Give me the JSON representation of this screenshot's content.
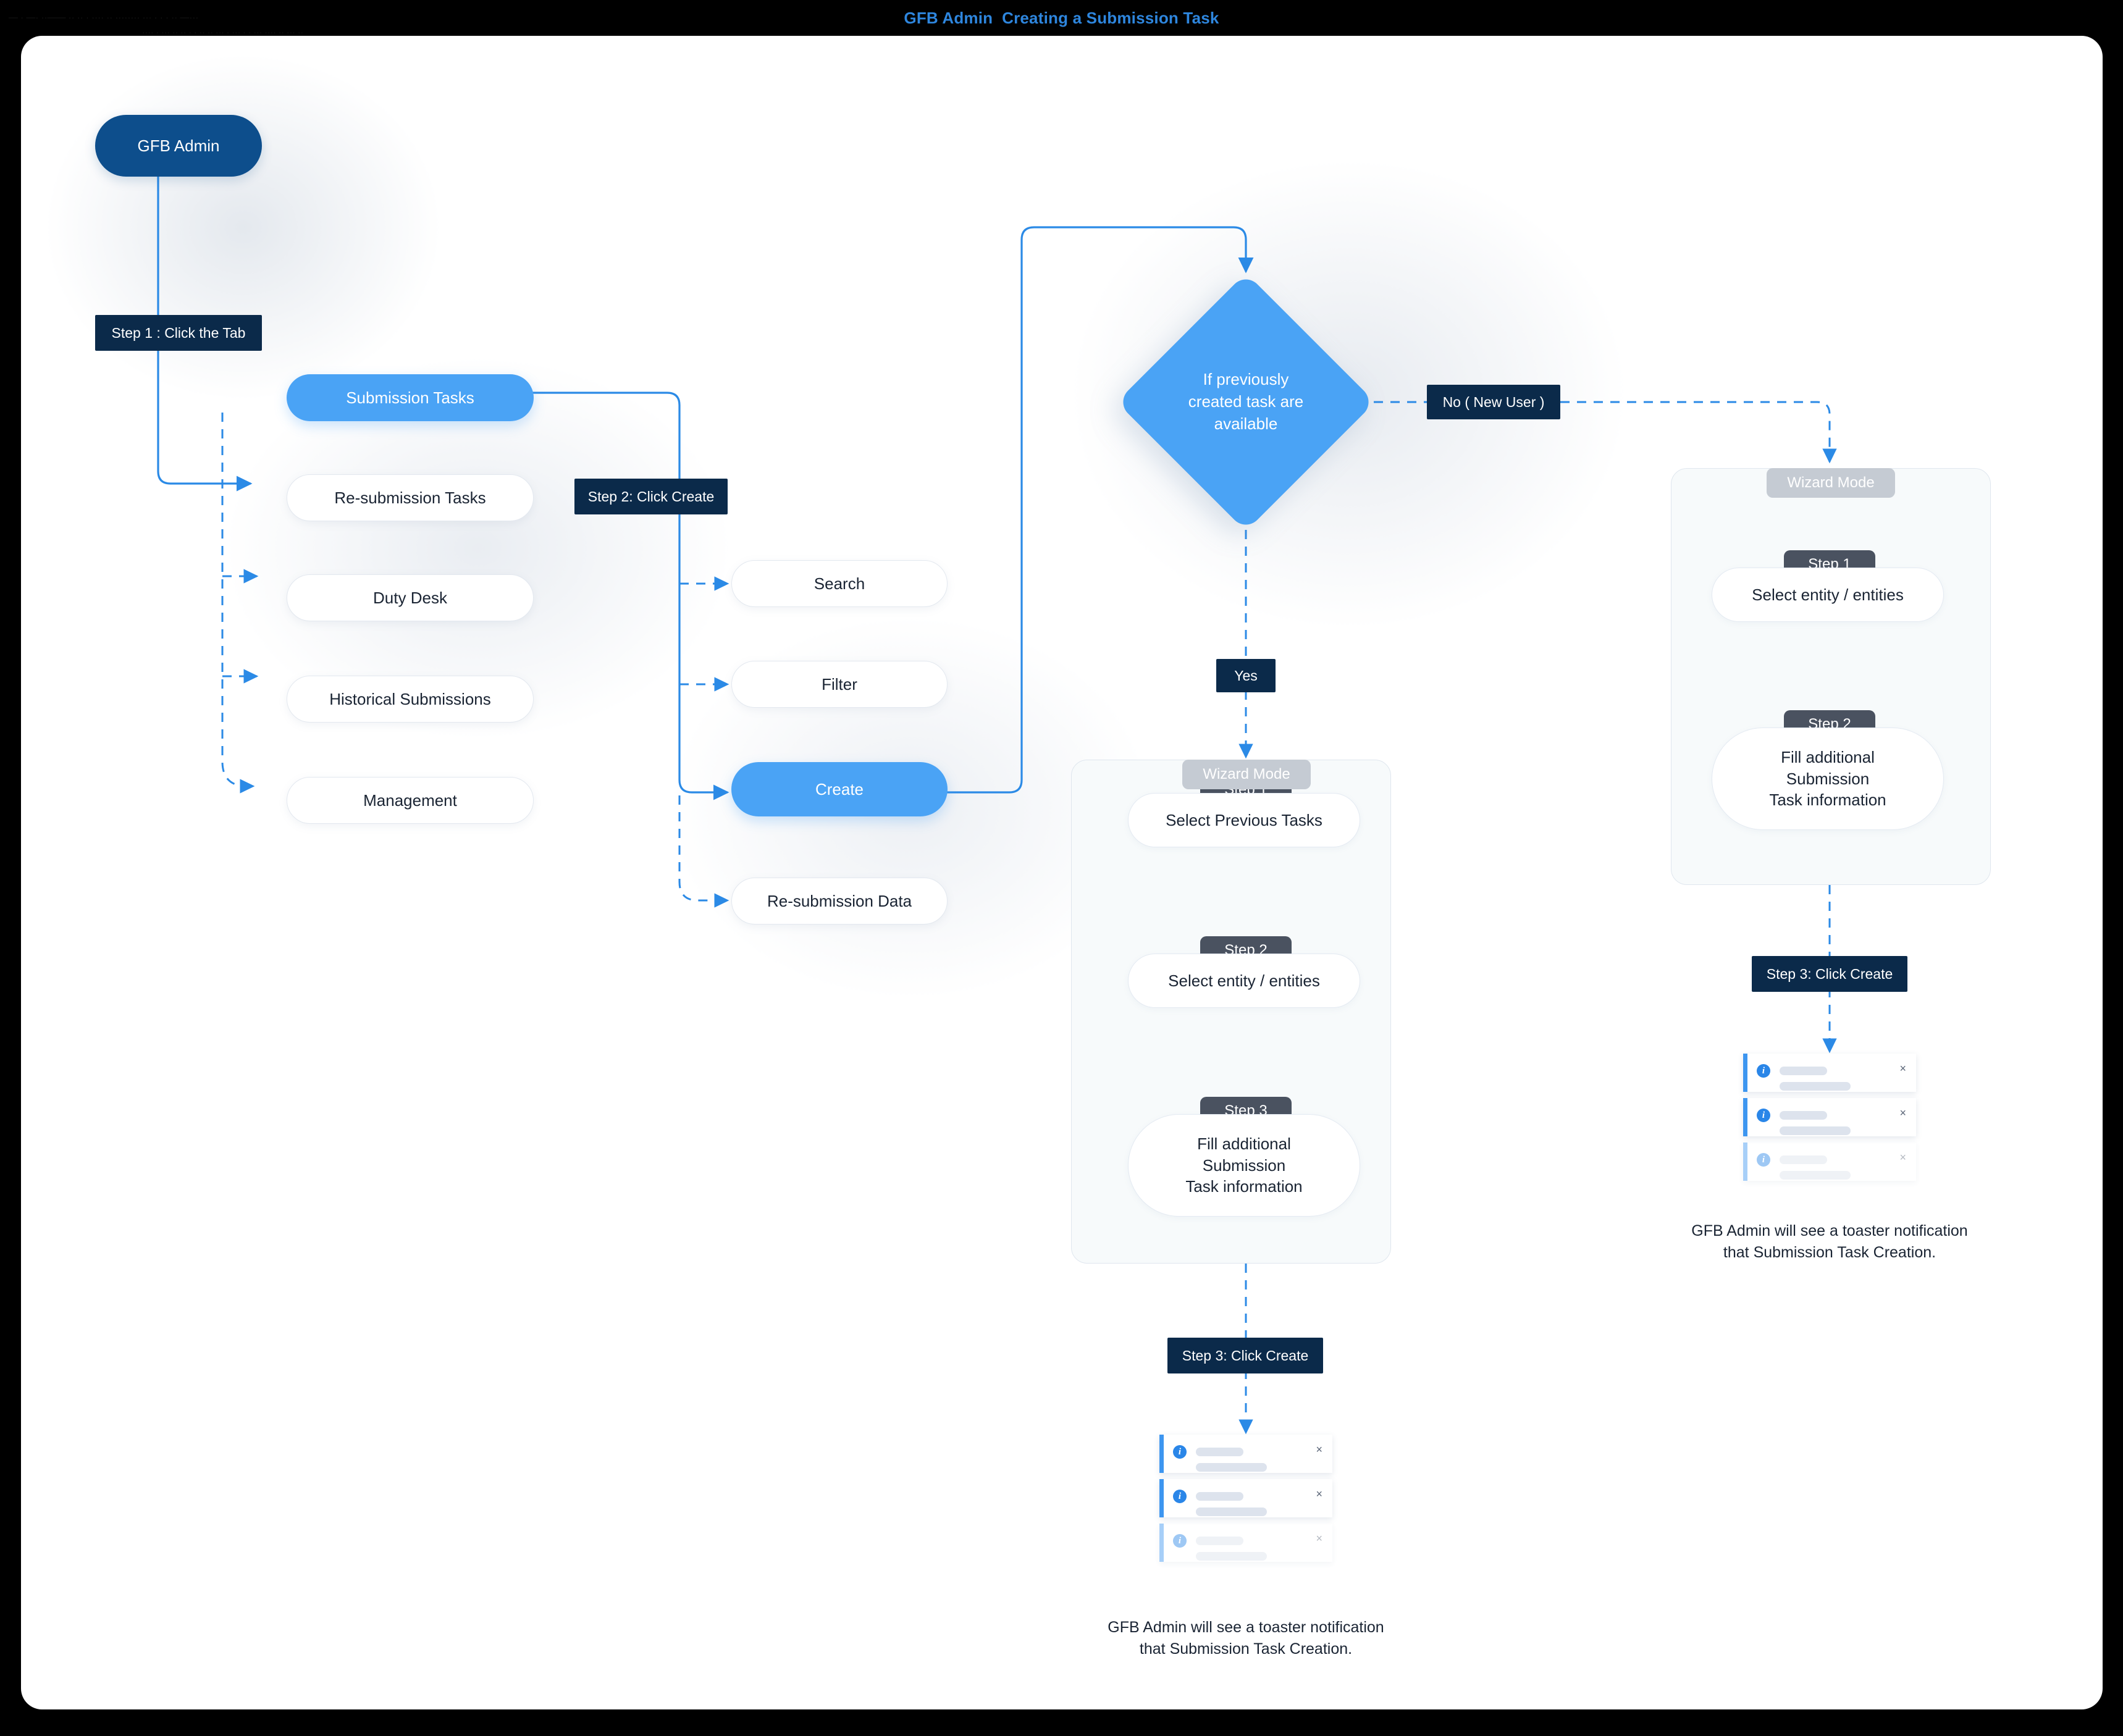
{
  "window": {
    "title": "GFB Admin  Creating a Submission Task",
    "faint_line_1": "— · —· ··——  ·· ·· · ···· ·· ········ ···  · · ·  ··   —···",
    "faint_line_2": "···· · ···  ·· ·· · · ·· ·· ··· · ··· · · ··· ···· ·· ··· ··"
  },
  "colors": {
    "background": "#000000",
    "canvas": "#ffffff",
    "title_blue": "#2e86de",
    "navy": "#0d4e8c",
    "tag_navy": "#0b2a4a",
    "accent_blue": "#4aa3f5",
    "edge_blue": "#2b8ae6",
    "step_badge_gray": "#4a5260",
    "wizard_badge_gray": "#c5cbd3",
    "panel_bg": "#f7fafb",
    "pill_border": "#e3e8ef",
    "text_dark": "#1a2433",
    "skeleton_gray": "#dde3ed",
    "toast_bar_blue": "#3d96f0"
  },
  "actor": {
    "label": "GFB Admin"
  },
  "steps": {
    "step1_tab": "Step 1 : Click the Tab",
    "step2_create": "Step 2: Click Create",
    "step3_create_center": "Step 3: Click Create",
    "step3_create_right": "Step 3: Click Create"
  },
  "tabs": {
    "active": "Submission Tasks",
    "items": [
      {
        "label": "Submission Tasks",
        "active": true
      },
      {
        "label": "Re-submission Tasks",
        "active": false
      },
      {
        "label": "Duty Desk",
        "active": false
      },
      {
        "label": "Historical Submissions",
        "active": false
      },
      {
        "label": "Management",
        "active": false
      }
    ]
  },
  "actions": {
    "items": [
      {
        "label": "Search",
        "active": false
      },
      {
        "label": "Filter",
        "active": false
      },
      {
        "label": "Create",
        "active": true
      },
      {
        "label": "Re-submission Data",
        "active": false
      }
    ]
  },
  "decision": {
    "text": "If previously\ncreated task are\navailable",
    "yes_label": "Yes",
    "no_label": "No ( New User )"
  },
  "wizard_yes": {
    "group_label": "Wizard Mode",
    "steps": [
      {
        "badge": "Step 1",
        "label": "Select Previous Tasks"
      },
      {
        "badge": "Step 2",
        "label": "Select entity / entities"
      },
      {
        "badge": "Step 3",
        "label": "Fill additional\nSubmission\nTask information"
      }
    ]
  },
  "wizard_no": {
    "group_label": "Wizard Mode",
    "steps": [
      {
        "badge": "Step 1",
        "label": "Select entity / entities"
      },
      {
        "badge": "Step 2",
        "label": "Fill additional\nSubmission\nTask information"
      }
    ]
  },
  "toaster_center": {
    "caption": "GFB Admin will see a toaster notification\nthat Submission Task Creation.",
    "items": [
      {
        "icon": "info-icon",
        "close": "×"
      },
      {
        "icon": "info-icon",
        "close": "×"
      },
      {
        "icon": "info-icon",
        "close": "×"
      }
    ]
  },
  "toaster_right": {
    "caption": "GFB Admin will see a toaster notification\nthat Submission Task Creation.",
    "items": [
      {
        "icon": "info-icon",
        "close": "×"
      },
      {
        "icon": "info-icon",
        "close": "×"
      },
      {
        "icon": "info-icon",
        "close": "×"
      }
    ]
  }
}
